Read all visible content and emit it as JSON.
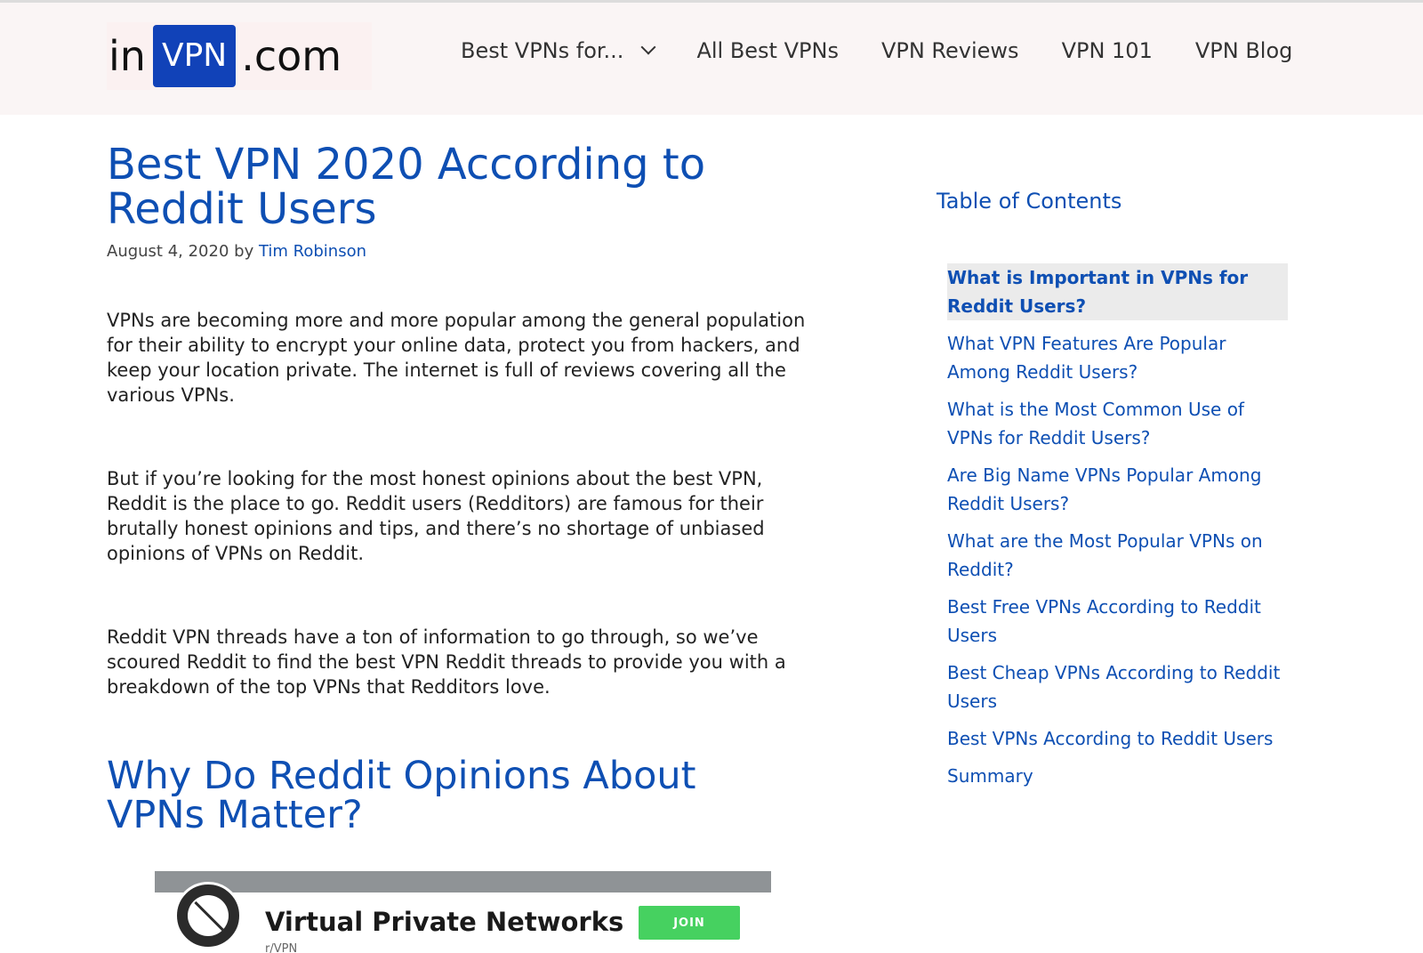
{
  "header": {
    "logo": {
      "prefix": "in",
      "badge": "VPN",
      "suffix": ".com"
    },
    "nav": [
      {
        "label": "Best VPNs for..."
      },
      {
        "label": "All Best VPNs"
      },
      {
        "label": "VPN Reviews"
      },
      {
        "label": "VPN 101"
      },
      {
        "label": "VPN Blog"
      }
    ]
  },
  "post": {
    "title": "Best VPN 2020 According to Reddit Users",
    "date": "August 4, 2020",
    "by": "by",
    "author": "Tim Robinson",
    "paragraphs": [
      "VPNs are becoming more and more popular among the general population for their ability to encrypt your online data, protect you from hackers, and keep your location private. The internet is full of reviews covering all the various VPNs.",
      "But if you’re looking for the most honest opinions about the best VPN, Reddit is the place to go. Reddit users (Redditors) are famous for their brutally honest opinions and tips, and there’s no shortage of unbiased opinions of VPNs on Reddit.",
      "Reddit VPN threads have a ton of information to go through, so we’ve scoured Reddit to find the best VPN Reddit threads to provide you with a breakdown of the top VPNs that Redditors love."
    ],
    "section_heading": "Why Do Reddit Opinions About VPNs Matter?",
    "image": {
      "community_name": "Virtual Private Networks",
      "subreddit": "r/VPN",
      "join_label": "JOIN"
    }
  },
  "toc": {
    "title": "Table of Contents",
    "items": [
      "What is Important in VPNs for Reddit Users?",
      "What VPN Features Are Popular Among Reddit Users?",
      "What is the Most Common Use of VPNs for Reddit Users?",
      "Are Big Name VPNs Popular Among Reddit Users?",
      "What are the Most Popular VPNs on Reddit?",
      "Best Free VPNs According to Reddit Users",
      "Best Cheap VPNs According to Reddit Users",
      "Best VPNs According to Reddit Users",
      "Summary"
    ]
  },
  "colors": {
    "brand_blue": "#0e4fb3",
    "logo_badge": "#1142b8",
    "join_green": "#46d160",
    "header_bg": "#faf5f5"
  }
}
